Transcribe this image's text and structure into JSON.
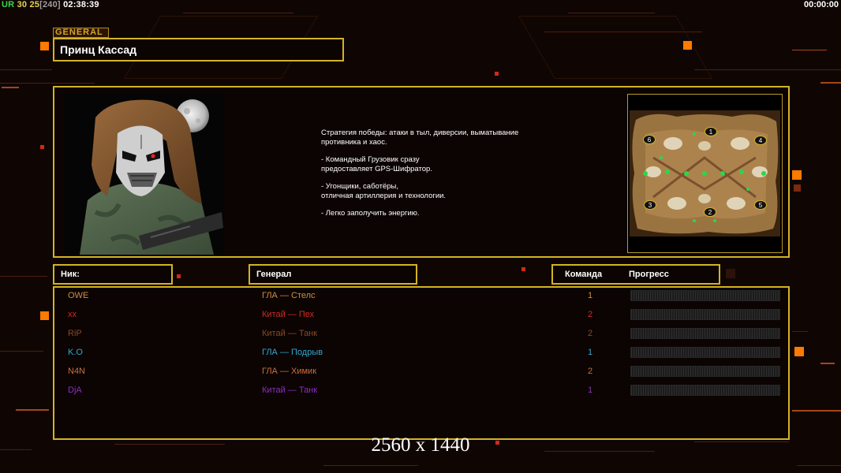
{
  "hud": {
    "ur_label": "UR",
    "val_a": "30",
    "val_b": "25",
    "val_c": "[240]",
    "clock_left": "02:38:39",
    "clock_right": "00:00:00"
  },
  "general": {
    "tag": "GENERAL",
    "name": "Принц Кассад",
    "description": [
      "Стратегия победы: атаки в тыл, диверсии, выматывание\n противника и хаос.",
      "- Командный Грузовик сразу\nпредоставляет GPS-Шифратор.",
      "- Угонщики, саботёры,\nотличная артиллерия и технологии.",
      "- Легко заполучить энергию."
    ]
  },
  "map": {
    "slots": [
      "1",
      "2",
      "3",
      "4",
      "5",
      "6"
    ]
  },
  "table": {
    "headers": {
      "nick": "Ник:",
      "general": "Генерал",
      "team": "Команда",
      "progress": "Прогресс"
    },
    "players": [
      {
        "nick": "OWE",
        "general": "ГЛА — Стелс",
        "team": "1",
        "color": "#d18d45",
        "progress": 0
      },
      {
        "nick": "xx",
        "general": "Китай — Пех",
        "team": "2",
        "color": "#d42a25",
        "progress": 0
      },
      {
        "nick": "RiP",
        "general": "Китай — Танк",
        "team": "2",
        "color": "#8a4a2a",
        "progress": 0
      },
      {
        "nick": "K.O",
        "general": "ГЛА — Подрыв",
        "team": "1",
        "color": "#2fa8d4",
        "progress": 0
      },
      {
        "nick": "N4N",
        "general": "ГЛА — Химик",
        "team": "2",
        "color": "#c9703e",
        "progress": 0
      },
      {
        "nick": "DjA",
        "general": "Китай — Танк",
        "team": "1",
        "color": "#8e2ec0",
        "progress": 0
      }
    ]
  },
  "resolution_label": "2560 x 1440",
  "colors": {
    "frame": "#d4b322",
    "background": "#0f0604",
    "accent_orange": "#ff7a00"
  }
}
